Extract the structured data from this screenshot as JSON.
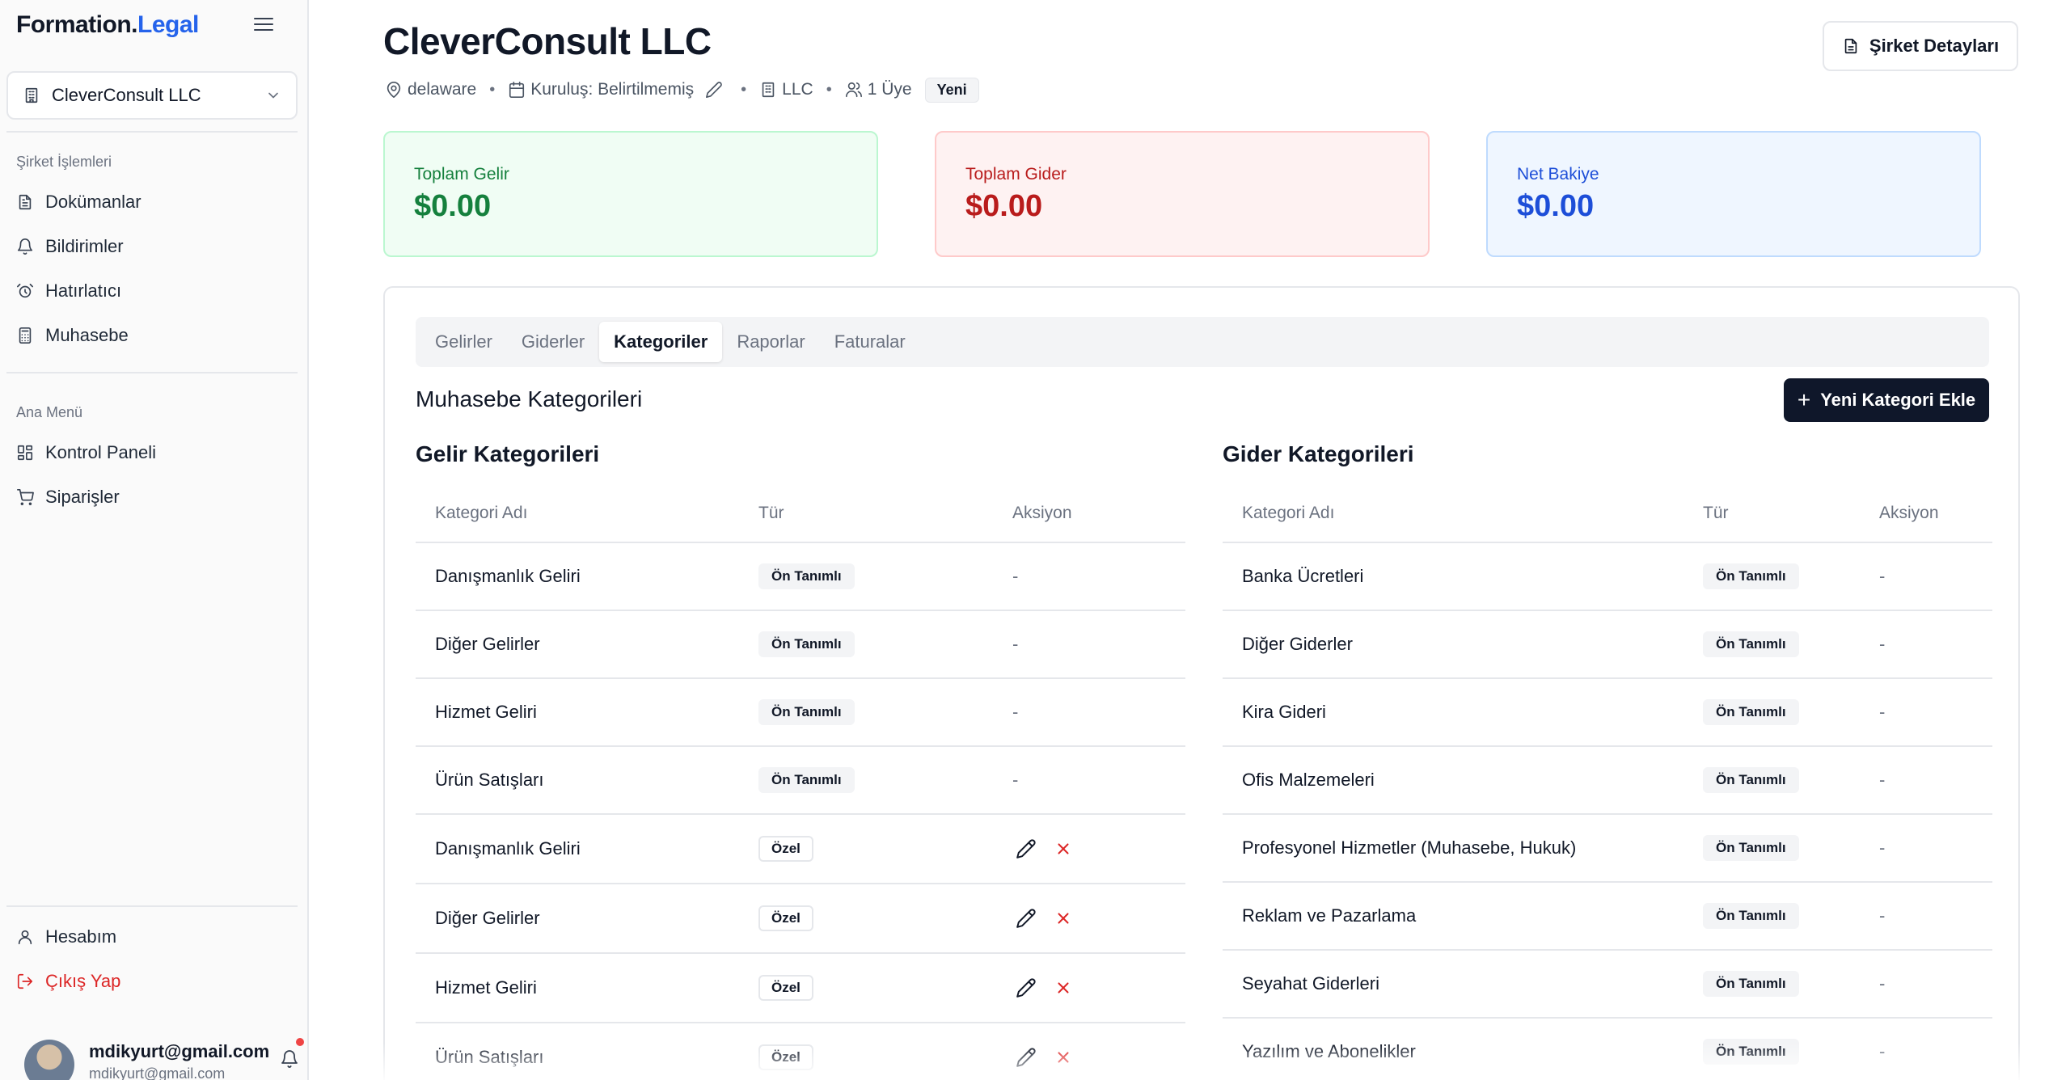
{
  "brand": {
    "part1": "Formation.",
    "part2": "Legal"
  },
  "sidebar": {
    "company": "CleverConsult LLC",
    "section1_label": "Şirket İşlemleri",
    "section1_items": [
      {
        "label": "Dokümanlar",
        "icon": "file-text-icon"
      },
      {
        "label": "Bildirimler",
        "icon": "bell-icon"
      },
      {
        "label": "Hatırlatıcı",
        "icon": "alarm-clock-icon"
      },
      {
        "label": "Muhasebe",
        "icon": "calculator-icon"
      }
    ],
    "section2_label": "Ana Menü",
    "section2_items": [
      {
        "label": "Kontrol Paneli",
        "icon": "dashboard-grid-icon"
      },
      {
        "label": "Siparişler",
        "icon": "shopping-cart-icon"
      }
    ],
    "account_label": "Hesabım",
    "logout_label": "Çıkış Yap",
    "user_name": "mdikyurt@gmail.com",
    "user_email": "mdikyurt@gmail.com"
  },
  "header": {
    "title": "CleverConsult LLC",
    "state": "delaware",
    "formation": "Kuruluş: Belirtilmemiş",
    "entity_type": "LLC",
    "members": "1 Üye",
    "badge": "Yeni",
    "details_button": "Şirket Detayları"
  },
  "stats": {
    "income_label": "Toplam Gelir",
    "income_value": "$0.00",
    "expense_label": "Toplam Gider",
    "expense_value": "$0.00",
    "net_label": "Net Bakiye",
    "net_value": "$0.00",
    "colors": {
      "income": "#15803d",
      "expense": "#b91c1c",
      "net": "#1d4ed8"
    }
  },
  "tabs": [
    "Gelirler",
    "Giderler",
    "Kategoriler",
    "Raporlar",
    "Faturalar"
  ],
  "active_tab": "Kategoriler",
  "section_title": "Muhasebe Kategorileri",
  "add_button": "Yeni Kategori Ekle",
  "income_table": {
    "title": "Gelir Kategorileri",
    "headers": [
      "Kategori Adı",
      "Tür",
      "Aksiyon"
    ],
    "rows": [
      {
        "name": "Danışmanlık Geliri",
        "type": "Ön Tanımlı",
        "action": "-"
      },
      {
        "name": "Diğer Gelirler",
        "type": "Ön Tanımlı",
        "action": "-"
      },
      {
        "name": "Hizmet Geliri",
        "type": "Ön Tanımlı",
        "action": "-"
      },
      {
        "name": "Ürün Satışları",
        "type": "Ön Tanımlı",
        "action": "-"
      },
      {
        "name": "Danışmanlık Geliri",
        "type": "Özel",
        "action": ""
      },
      {
        "name": "Diğer Gelirler",
        "type": "Özel",
        "action": ""
      },
      {
        "name": "Hizmet Geliri",
        "type": "Özel",
        "action": ""
      },
      {
        "name": "Ürün Satışları",
        "type": "Özel",
        "action": ""
      }
    ]
  },
  "expense_table": {
    "title": "Gider Kategorileri",
    "headers": [
      "Kategori Adı",
      "Tür",
      "Aksiyon"
    ],
    "rows": [
      {
        "name": "Banka Ücretleri",
        "type": "Ön Tanımlı",
        "action": "-"
      },
      {
        "name": "Diğer Giderler",
        "type": "Ön Tanımlı",
        "action": "-"
      },
      {
        "name": "Kira Gideri",
        "type": "Ön Tanımlı",
        "action": "-"
      },
      {
        "name": "Ofis Malzemeleri",
        "type": "Ön Tanımlı",
        "action": "-"
      },
      {
        "name": "Profesyonel Hizmetler (Muhasebe, Hukuk)",
        "type": "Ön Tanımlı",
        "action": "-"
      },
      {
        "name": "Reklam ve Pazarlama",
        "type": "Ön Tanımlı",
        "action": "-"
      },
      {
        "name": "Seyahat Giderleri",
        "type": "Ön Tanımlı",
        "action": "-"
      },
      {
        "name": "Yazılım ve Abonelikler",
        "type": "Ön Tanımlı",
        "action": "-"
      }
    ]
  }
}
